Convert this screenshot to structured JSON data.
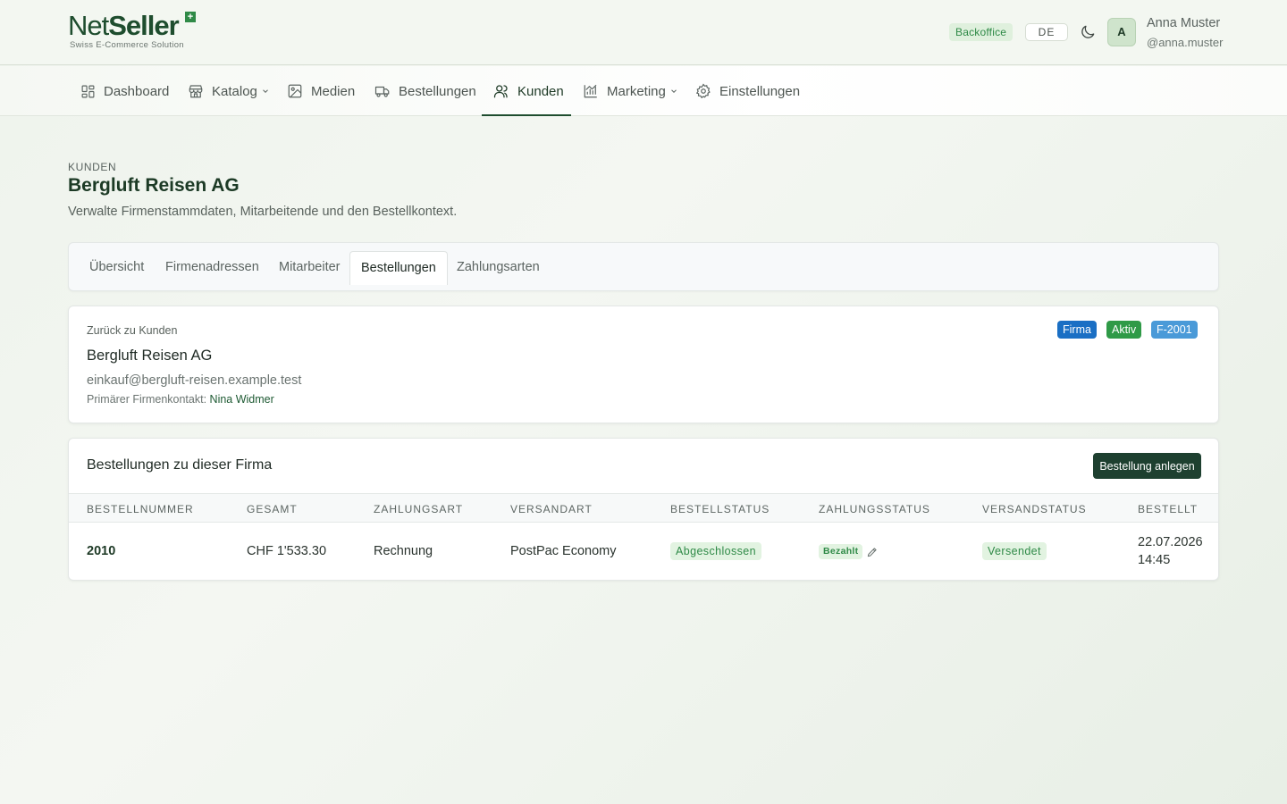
{
  "brand": {
    "name_light": "Net",
    "name_bold": "Seller",
    "plus": "+",
    "tagline": "Swiss E-Commerce Solution"
  },
  "header": {
    "badge": "Backoffice",
    "language": "DE",
    "theme_icon": "moon-icon",
    "avatar_initial": "A",
    "user_name": "Anna Muster",
    "user_handle": "@anna.muster"
  },
  "nav": {
    "items": [
      {
        "label": "Dashboard",
        "icon": "dashboard-icon"
      },
      {
        "label": "Katalog",
        "icon": "store-icon",
        "dropdown": true
      },
      {
        "label": "Medien",
        "icon": "image-icon"
      },
      {
        "label": "Bestellungen",
        "icon": "truck-icon"
      },
      {
        "label": "Kunden",
        "icon": "users-icon",
        "active": true
      },
      {
        "label": "Marketing",
        "icon": "chart-icon",
        "dropdown": true
      },
      {
        "label": "Einstellungen",
        "icon": "gear-icon"
      }
    ]
  },
  "page": {
    "eyebrow": "KUNDEN",
    "title": "Bergluft Reisen AG",
    "subtitle": "Verwalte Firmenstammdaten, Mitarbeitende und den Bestellkontext."
  },
  "tabs": [
    {
      "label": "Übersicht"
    },
    {
      "label": "Firmenadressen"
    },
    {
      "label": "Mitarbeiter"
    },
    {
      "label": "Bestellungen",
      "active": true
    },
    {
      "label": "Zahlungsarten"
    }
  ],
  "customer": {
    "back_label": "Zurück zu Kunden",
    "name": "Bergluft Reisen AG",
    "email": "einkauf@bergluft-reisen.example.test",
    "contact_label": "Primärer Firmenkontakt:",
    "contact_name": "Nina Widmer",
    "badges": [
      {
        "label": "Firma",
        "color": "#1a6fc4"
      },
      {
        "label": "Aktiv",
        "color": "#2f9a47"
      },
      {
        "label": "F-2001",
        "color": "#4a9ad8"
      }
    ]
  },
  "orders": {
    "title": "Bestellungen zu dieser Firma",
    "create_label": "Bestellung anlegen",
    "columns": [
      "BESTELLNUMMER",
      "GESAMT",
      "ZAHLUNGSART",
      "VERSANDART",
      "BESTELLSTATUS",
      "ZAHLUNGSSTATUS",
      "VERSANDSTATUS",
      "BESTELLT"
    ],
    "rows": [
      {
        "number": "2010",
        "total": "CHF 1'533.30",
        "payment_method": "Rechnung",
        "shipping_method": "PostPac Economy",
        "order_status": "Abgeschlossen",
        "payment_status": "Bezahlt",
        "shipping_status": "Versendet",
        "ordered_date": "22.07.2026",
        "ordered_time": "14:45"
      }
    ]
  },
  "colors": {
    "brand_dark": "#1e4d2e",
    "accent_green": "#2f8a47",
    "button_dark": "#1e4030"
  }
}
